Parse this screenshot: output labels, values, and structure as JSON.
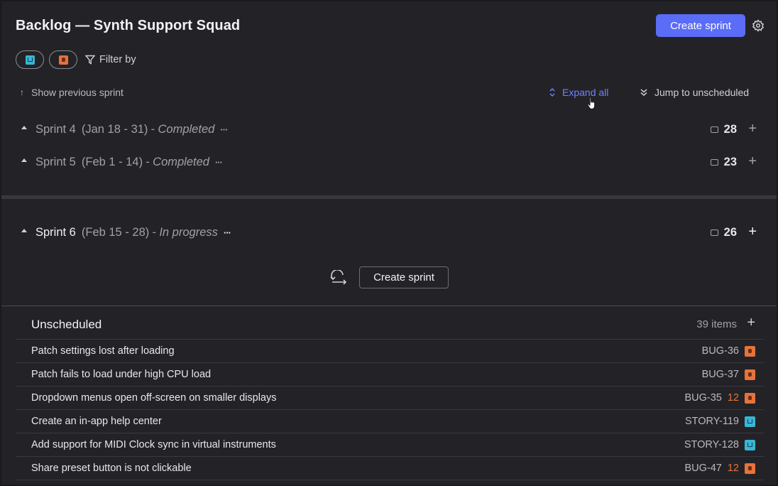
{
  "header": {
    "title": "Backlog — Synth Support Squad",
    "create_sprint_label": "Create sprint"
  },
  "filters": {
    "filter_by_label": "Filter by"
  },
  "toolbar": {
    "show_previous_label": "Show previous sprint",
    "expand_all_label": "Expand all",
    "jump_label": "Jump to unscheduled"
  },
  "sprints": [
    {
      "name": "Sprint 4",
      "dates": "(Jan 18 - 31)",
      "status": "- Completed",
      "count": "28"
    },
    {
      "name": "Sprint 5",
      "dates": "(Feb 1 - 14)",
      "status": "- Completed",
      "count": "23"
    },
    {
      "name": "Sprint 6",
      "dates": "(Feb 15 - 28)",
      "status": "- In progress",
      "count": "26"
    }
  ],
  "create_sprint_secondary_label": "Create sprint",
  "unscheduled": {
    "title": "Unscheduled",
    "count_label": "39 items",
    "items": [
      {
        "title": "Patch settings lost after loading",
        "key": "BUG-36",
        "points": "",
        "type": "bug"
      },
      {
        "title": "Patch fails to load under high CPU load",
        "key": "BUG-37",
        "points": "",
        "type": "bug"
      },
      {
        "title": "Dropdown menus open off-screen on smaller displays",
        "key": "BUG-35",
        "points": "12",
        "type": "bug"
      },
      {
        "title": "Create an in-app help center",
        "key": "STORY-119",
        "points": "",
        "type": "story"
      },
      {
        "title": "Add support for MIDI Clock sync in virtual instruments",
        "key": "STORY-128",
        "points": "",
        "type": "story"
      },
      {
        "title": "Share preset button is not clickable",
        "key": "BUG-47",
        "points": "12",
        "type": "bug"
      }
    ]
  },
  "colors": {
    "accent": "#5b6cf6",
    "link": "#6d82ff",
    "story": "#38b6d4",
    "bug": "#e5733a",
    "background": "#232327"
  },
  "icons": [
    "gear-icon",
    "story-type-icon",
    "bug-type-icon",
    "filter-icon",
    "arrow-up-icon",
    "expand-icon",
    "chevrons-down-icon",
    "caret-up-icon",
    "more-icon",
    "sprint-count-icon",
    "plus-icon",
    "repeat-icon",
    "pointer-cursor-icon"
  ]
}
